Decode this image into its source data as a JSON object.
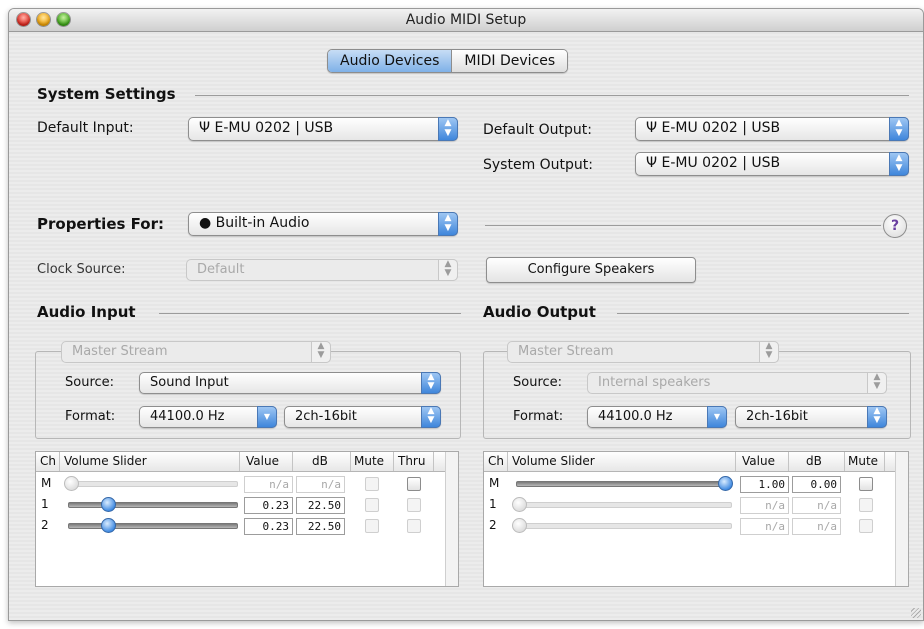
{
  "window": {
    "title": "Audio MIDI Setup"
  },
  "tabs": [
    {
      "label": "Audio Devices",
      "selected": true
    },
    {
      "label": "MIDI Devices",
      "selected": false
    }
  ],
  "system_settings": {
    "heading": "System Settings",
    "default_input": {
      "label": "Default Input:",
      "value": "E-MU 0202 | USB",
      "icon": "usb-icon"
    },
    "default_output": {
      "label": "Default Output:",
      "value": "E-MU 0202 | USB",
      "icon": "usb-icon"
    },
    "system_output": {
      "label": "System Output:",
      "value": "E-MU 0202 | USB",
      "icon": "usb-icon"
    }
  },
  "properties": {
    "label": "Properties For:",
    "value": "Built-in Audio",
    "icon": "apple-icon",
    "help": "?",
    "clock_source_label": "Clock Source:",
    "clock_source_value": "Default",
    "configure_speakers": "Configure Speakers"
  },
  "audio_input": {
    "heading": "Audio Input",
    "stream": "Master Stream",
    "source_label": "Source:",
    "source_value": "Sound Input",
    "format_label": "Format:",
    "format_rate": "44100.0 Hz",
    "format_bits": "2ch-16bit",
    "columns": [
      "Ch",
      "Volume Slider",
      "Value",
      "dB",
      "Mute",
      "Thru"
    ],
    "rows": [
      {
        "ch": "M",
        "value": "n/a",
        "db": "n/a",
        "level": 0.0,
        "enabled": false
      },
      {
        "ch": "1",
        "value": "0.23",
        "db": "22.50",
        "level": 0.23,
        "enabled": true
      },
      {
        "ch": "2",
        "value": "0.23",
        "db": "22.50",
        "level": 0.23,
        "enabled": true
      }
    ]
  },
  "audio_output": {
    "heading": "Audio Output",
    "stream": "Master Stream",
    "source_label": "Source:",
    "source_value": "Internal speakers",
    "format_label": "Format:",
    "format_rate": "44100.0 Hz",
    "format_bits": "2ch-16bit",
    "columns": [
      "Ch",
      "Volume Slider",
      "Value",
      "dB",
      "Mute"
    ],
    "rows": [
      {
        "ch": "M",
        "value": "1.00",
        "db": "0.00",
        "level": 1.0,
        "enabled": true
      },
      {
        "ch": "1",
        "value": "n/a",
        "db": "n/a",
        "level": 0.0,
        "enabled": false
      },
      {
        "ch": "2",
        "value": "n/a",
        "db": "n/a",
        "level": 0.0,
        "enabled": false
      }
    ]
  },
  "colors": {
    "accent": "#3f86db",
    "tab_selected": "#9ec6f3"
  }
}
